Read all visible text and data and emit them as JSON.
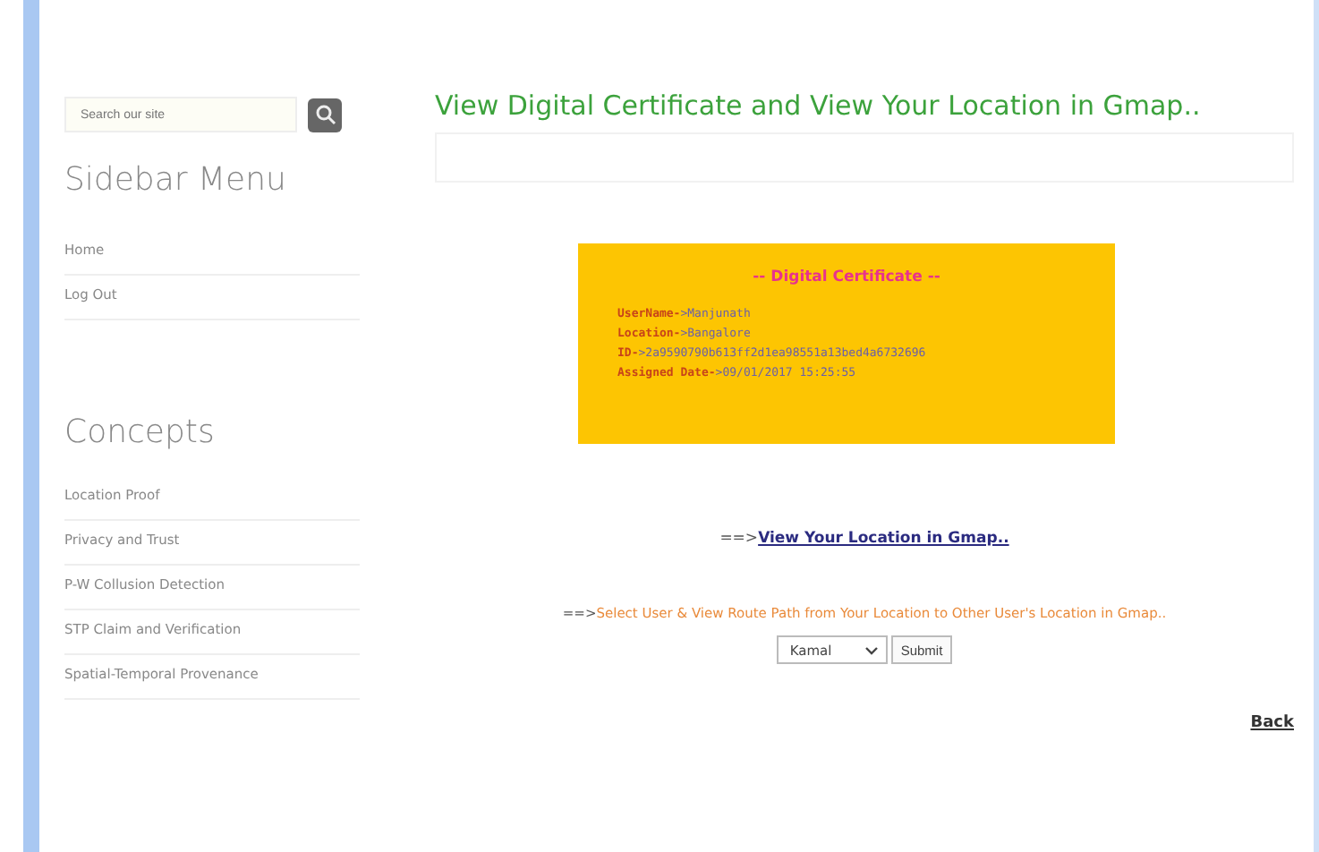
{
  "search": {
    "placeholder": "Search our site"
  },
  "sidebar_menu": {
    "title": "Sidebar Menu",
    "items": [
      "Home",
      "Log Out"
    ]
  },
  "concepts": {
    "title": "Concepts",
    "items": [
      "Location Proof",
      "Privacy and Trust",
      "P-W Collusion Detection",
      "STP Claim and Verification",
      "Spatial-Temporal Provenance"
    ]
  },
  "main": {
    "title": "View Digital Certificate and View Your Location in Gmap..",
    "certificate": {
      "heading": "-- Digital Certificate --",
      "fields": [
        {
          "label": "UserName-",
          "value": ">Manjunath"
        },
        {
          "label": "Location-",
          "value": ">Bangalore"
        },
        {
          "label": "ID-",
          "value": ">2a9590790b613ff2d1ea98551a13bed4a6732696"
        },
        {
          "label": "Assigned Date-",
          "value": ">09/01/2017 15:25:55"
        }
      ]
    },
    "location_link": {
      "prefix": "==>",
      "text": "View Your Location in Gmap.."
    },
    "route": {
      "prefix": "==>",
      "text": "Select User & View Route Path from Your Location to Other User's Location in Gmap.."
    },
    "user_select": {
      "value": "Kamal"
    },
    "submit": "Submit",
    "back": "Back"
  }
}
